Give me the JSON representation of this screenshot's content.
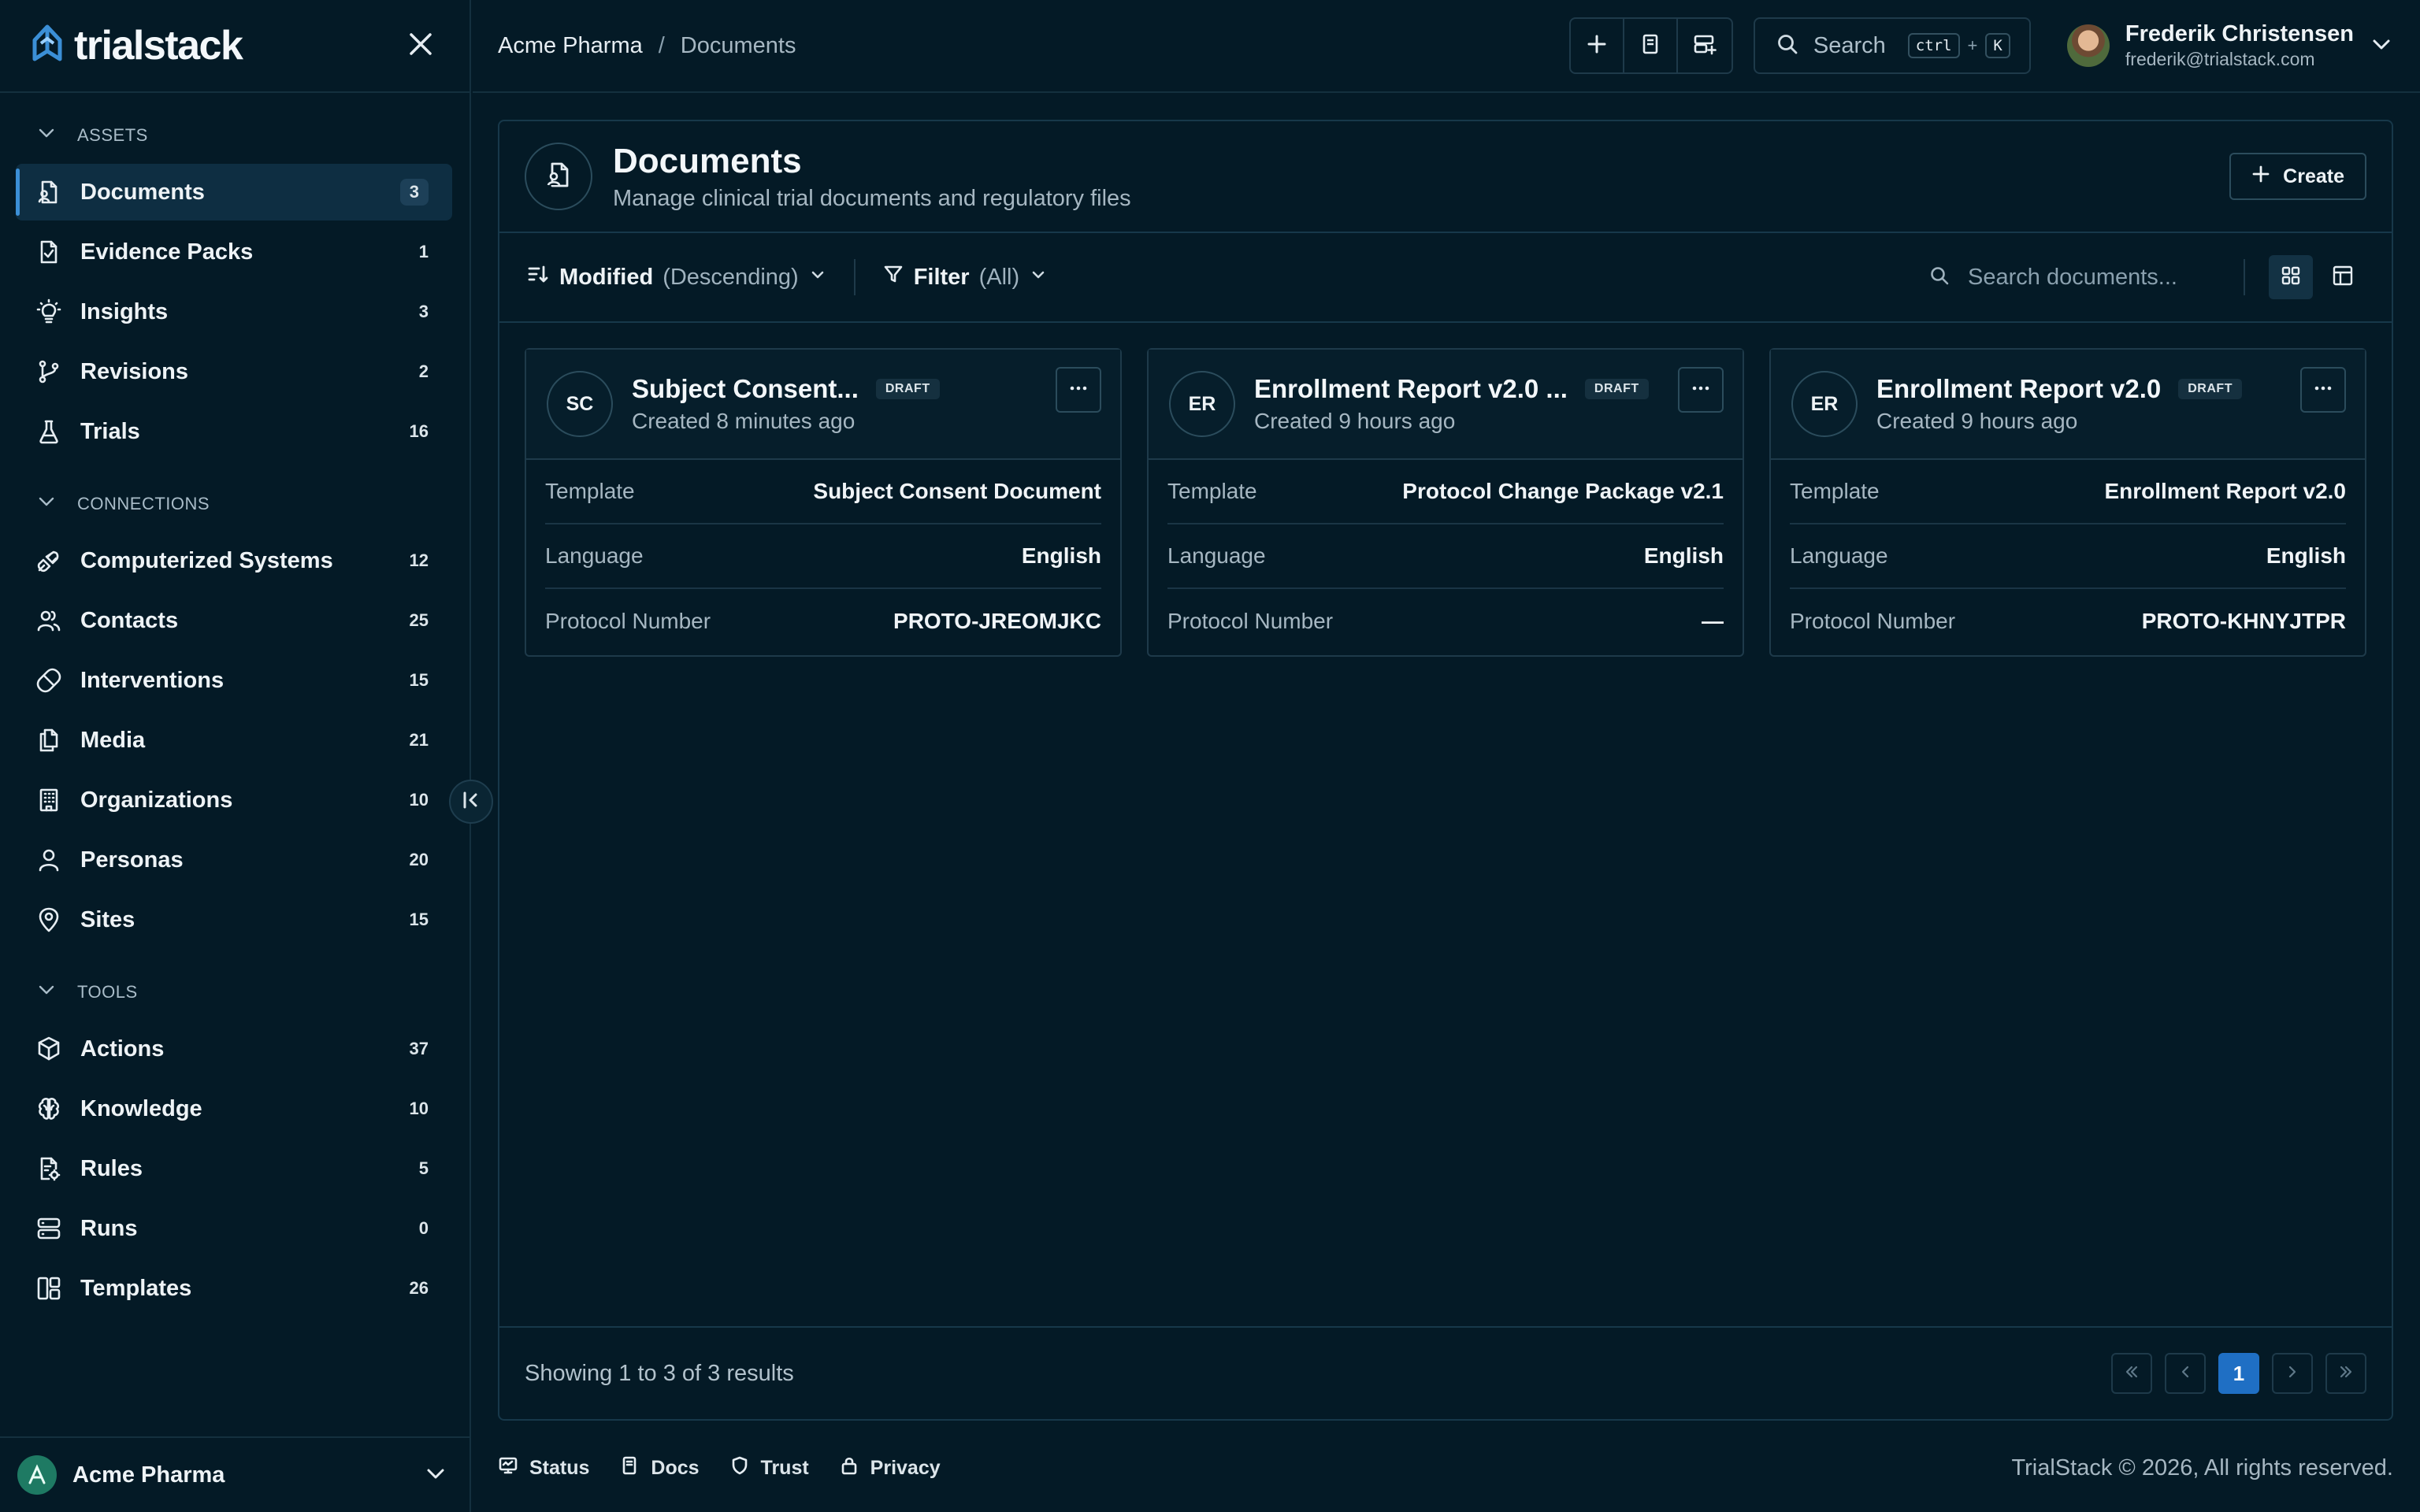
{
  "app": {
    "brand": "trialstack"
  },
  "breadcrumb": {
    "root": "Acme Pharma",
    "separator": "/",
    "current": "Documents"
  },
  "topbar": {
    "search_label": "Search",
    "shortcut_mod": "ctrl",
    "shortcut_plus": "+",
    "shortcut_key": "K",
    "icons": [
      "plus-icon",
      "document-icon",
      "runs-icon"
    ]
  },
  "user": {
    "name": "Frederik Christensen",
    "email": "frederik@trialstack.com"
  },
  "sidebar": {
    "sections": [
      {
        "title": "ASSETS",
        "items": [
          {
            "label": "Documents",
            "count": "3",
            "icon": "document-icon",
            "active": true
          },
          {
            "label": "Evidence Packs",
            "count": "1",
            "icon": "evidence-icon"
          },
          {
            "label": "Insights",
            "count": "3",
            "icon": "lightbulb-icon"
          },
          {
            "label": "Revisions",
            "count": "2",
            "icon": "git-branch-icon"
          },
          {
            "label": "Trials",
            "count": "16",
            "icon": "flask-icon"
          }
        ]
      },
      {
        "title": "CONNECTIONS",
        "items": [
          {
            "label": "Computerized Systems",
            "count": "12",
            "icon": "plug-icon"
          },
          {
            "label": "Contacts",
            "count": "25",
            "icon": "users-icon"
          },
          {
            "label": "Interventions",
            "count": "15",
            "icon": "pill-icon"
          },
          {
            "label": "Media",
            "count": "21",
            "icon": "files-icon"
          },
          {
            "label": "Organizations",
            "count": "10",
            "icon": "building-icon"
          },
          {
            "label": "Personas",
            "count": "20",
            "icon": "user-icon"
          },
          {
            "label": "Sites",
            "count": "15",
            "icon": "map-pin-icon"
          }
        ]
      },
      {
        "title": "TOOLS",
        "items": [
          {
            "label": "Actions",
            "count": "37",
            "icon": "box-icon"
          },
          {
            "label": "Knowledge",
            "count": "10",
            "icon": "brain-icon"
          },
          {
            "label": "Rules",
            "count": "5",
            "icon": "rules-icon"
          },
          {
            "label": "Runs",
            "count": "0",
            "icon": "server-icon"
          },
          {
            "label": "Templates",
            "count": "26",
            "icon": "template-icon"
          }
        ]
      }
    ],
    "org": "Acme Pharma"
  },
  "page": {
    "title": "Documents",
    "subtitle": "Manage clinical trial documents and regulatory files",
    "create_label": "Create"
  },
  "toolbar": {
    "sort_label": "Modified",
    "sort_value": "(Descending)",
    "filter_label": "Filter",
    "filter_value": "(All)",
    "search_placeholder": "Search documents..."
  },
  "cards": [
    {
      "initials": "SC",
      "title": "Subject Consent...",
      "badge": "DRAFT",
      "created": "Created 8 minutes ago",
      "rows": [
        {
          "key": "Template",
          "value": "Subject Consent Document"
        },
        {
          "key": "Language",
          "value": "English"
        },
        {
          "key": "Protocol Number",
          "value": "PROTO-JREOMJKC"
        }
      ]
    },
    {
      "initials": "ER",
      "title": "Enrollment Report v2.0 ...",
      "badge": "DRAFT",
      "created": "Created 9 hours ago",
      "rows": [
        {
          "key": "Template",
          "value": "Protocol Change Package v2.1"
        },
        {
          "key": "Language",
          "value": "English"
        },
        {
          "key": "Protocol Number",
          "value": "—"
        }
      ]
    },
    {
      "initials": "ER",
      "title": "Enrollment Report v2.0",
      "badge": "DRAFT",
      "created": "Created 9 hours ago",
      "rows": [
        {
          "key": "Template",
          "value": "Enrollment Report v2.0"
        },
        {
          "key": "Language",
          "value": "English"
        },
        {
          "key": "Protocol Number",
          "value": "PROTO-KHNYJTPR"
        }
      ]
    }
  ],
  "pagination": {
    "summary": "Showing 1 to 3 of 3 results",
    "current_page": "1"
  },
  "footer": {
    "links": [
      {
        "label": "Status",
        "icon": "status-icon"
      },
      {
        "label": "Docs",
        "icon": "book-icon"
      },
      {
        "label": "Trust",
        "icon": "shield-icon"
      },
      {
        "label": "Privacy",
        "icon": "lock-icon"
      }
    ],
    "copyright": "TrialStack © 2026, All rights reserved."
  },
  "colors": {
    "background": "#041a26",
    "accent": "#3b8fd6",
    "active_page": "#1f6fc4",
    "border": "#1e3a4a"
  }
}
